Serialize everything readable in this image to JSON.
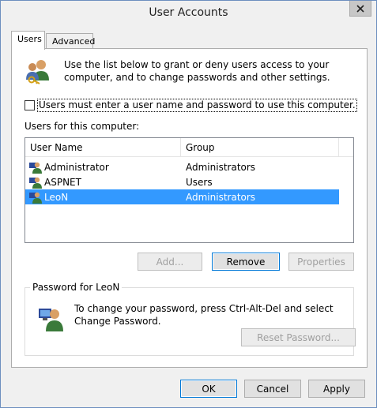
{
  "window": {
    "title": "User Accounts"
  },
  "tabs": [
    {
      "label": "Users",
      "active": true
    },
    {
      "label": "Advanced",
      "active": false
    }
  ],
  "intro": {
    "text": "Use the list below to grant or deny users access to your computer, and to change passwords and other settings.",
    "icon": "users-keys-icon"
  },
  "require_login": {
    "label": "Users must enter a user name and password to use this computer.",
    "checked": false
  },
  "users_list": {
    "label": "Users for this computer:",
    "columns": [
      "User Name",
      "Group"
    ],
    "rows": [
      {
        "name": "Administrator",
        "group": "Administrators",
        "selected": false
      },
      {
        "name": "ASPNET",
        "group": "Users",
        "selected": false
      },
      {
        "name": "LeoN",
        "group": "Administrators",
        "selected": true
      }
    ]
  },
  "list_buttons": {
    "add": "Add...",
    "remove": "Remove",
    "properties": "Properties"
  },
  "password_group": {
    "title": "Password for LeoN",
    "text": "To change your password, press Ctrl-Alt-Del and select Change Password.",
    "reset": "Reset Password..."
  },
  "footer": {
    "ok": "OK",
    "cancel": "Cancel",
    "apply": "Apply"
  },
  "colors": {
    "selection": "#3399ff",
    "focus_border": "#0078d7"
  }
}
